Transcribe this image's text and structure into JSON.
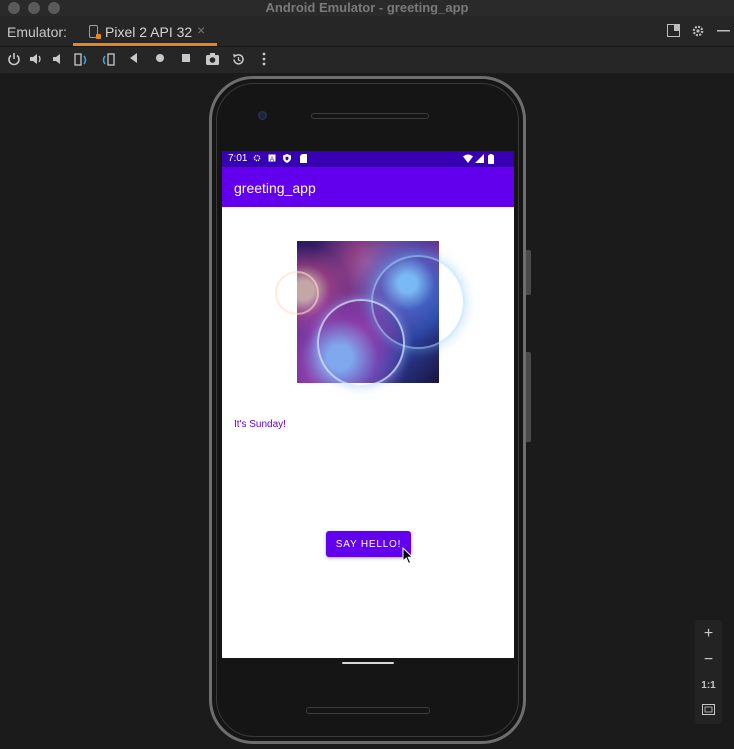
{
  "window": {
    "title": "Android Emulator - greeting_app"
  },
  "tabbar": {
    "emulator_label": "Emulator:",
    "device_tab_label": "Pixel 2 API 32",
    "close_glyph": "×"
  },
  "toolbar": {
    "icons": [
      "power-icon",
      "volume-up-icon",
      "volume-down-icon",
      "rotate-left-icon",
      "rotate-right-icon",
      "back-icon",
      "home-icon",
      "overview-icon",
      "screenshot-icon",
      "snapshot-icon",
      "more-icon"
    ]
  },
  "phone": {
    "status_bar": {
      "time": "7:01",
      "bg_color": "#3700b3"
    },
    "app_bar": {
      "title": "greeting_app",
      "bg_color": "#6200ee"
    },
    "content": {
      "image_alt": "space-planets-image",
      "message": "It's Sunday!",
      "button_label": "SAY HELLO!"
    }
  },
  "zoom_controls": {
    "zoom_in": "+",
    "zoom_out": "−",
    "actual_size": "1:1"
  },
  "colors": {
    "accent_tab": "#e8871e",
    "primary": "#6200ee",
    "primary_dark": "#3700b3"
  }
}
